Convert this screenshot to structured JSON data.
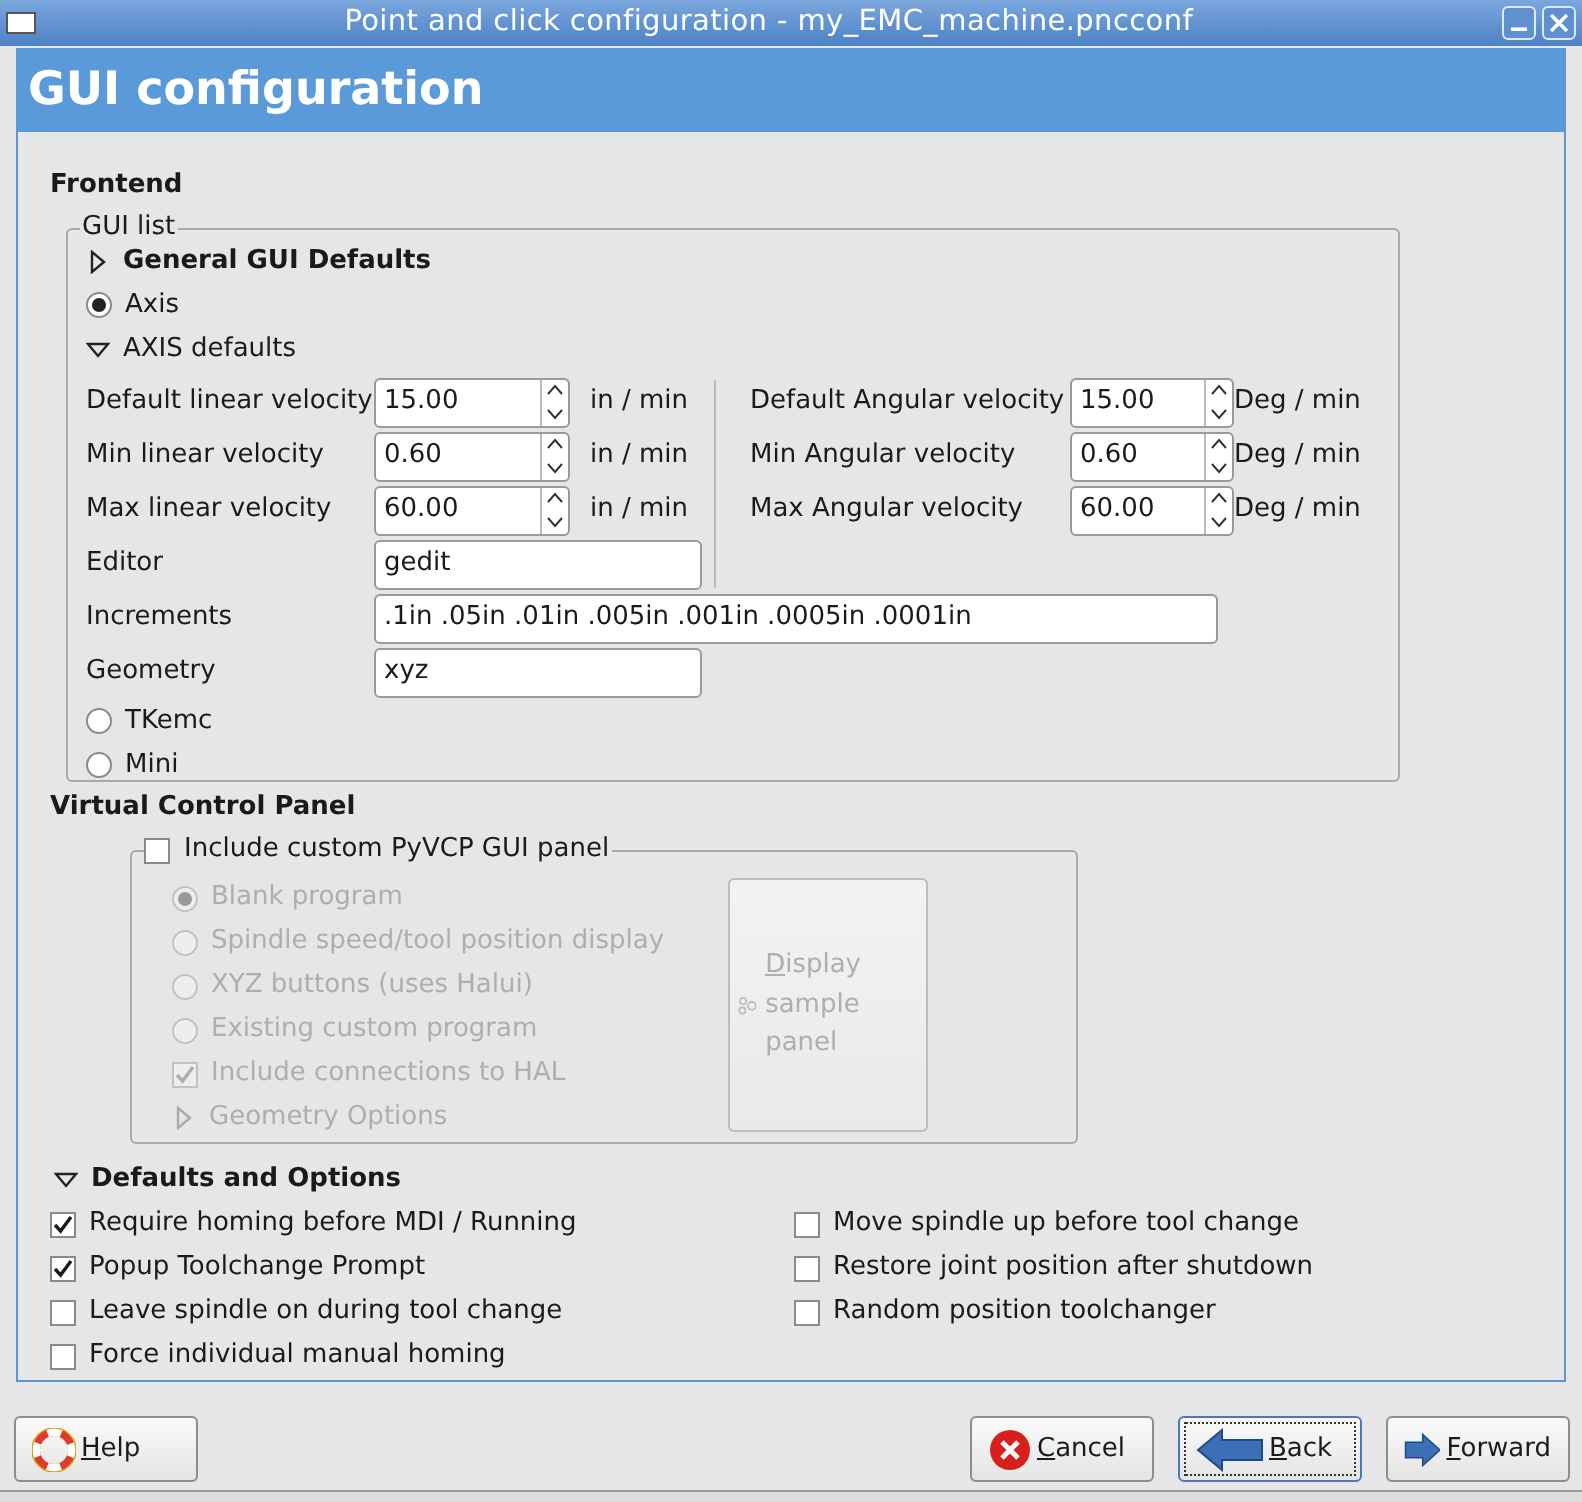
{
  "window": {
    "title": "Point and click configuration - my_EMC_machine.pncconf"
  },
  "header": {
    "title": "GUI configuration"
  },
  "frontend": {
    "title": "Frontend",
    "gui_list": {
      "legend": "GUI list",
      "general_defaults": {
        "label": "General GUI Defaults",
        "expanded": false
      },
      "frontends": [
        {
          "label": "Axis",
          "selected": true
        },
        {
          "label": "TKemc",
          "selected": false
        },
        {
          "label": "Mini",
          "selected": false
        }
      ],
      "axis_defaults": {
        "label": "AXIS defaults",
        "expanded": true,
        "linear_fields": [
          {
            "label": "Default linear velocity",
            "value": "15.00",
            "unit": "in / min"
          },
          {
            "label": "Min linear velocity",
            "value": "0.60",
            "unit": "in / min"
          },
          {
            "label": "Max linear velocity",
            "value": "60.00",
            "unit": "in / min"
          }
        ],
        "angular_fields": [
          {
            "label": "Default Angular velocity",
            "value": "15.00",
            "unit": "Deg / min"
          },
          {
            "label": "Min Angular velocity",
            "value": "0.60",
            "unit": "Deg / min"
          },
          {
            "label": "Max Angular velocity",
            "value": "60.00",
            "unit": "Deg / min"
          }
        ],
        "text_fields": [
          {
            "label": "Editor",
            "value": "gedit",
            "kind": "short"
          },
          {
            "label": "Increments",
            "value": ".1in .05in .01in .005in .001in .0005in .0001in",
            "kind": "long"
          },
          {
            "label": "Geometry",
            "value": "xyz",
            "kind": "short"
          }
        ]
      }
    }
  },
  "vcp": {
    "title": "Virtual Control Panel",
    "include": {
      "label": "Include custom PyVCP GUI panel",
      "checked": false
    },
    "disabled": true,
    "options": [
      {
        "label": "Blank program",
        "selected": true
      },
      {
        "label": "Spindle speed/tool position display",
        "selected": false
      },
      {
        "label": "XYZ buttons (uses Halui)",
        "selected": false
      },
      {
        "label": "Existing custom program",
        "selected": false
      }
    ],
    "hal": {
      "label": "Include connections to HAL",
      "checked": true
    },
    "geometry_options": {
      "label": "Geometry Options",
      "expanded": false
    },
    "display_button": {
      "label": "Display sample panel"
    }
  },
  "defaults": {
    "label": "Defaults and Options",
    "expanded": true,
    "left_options": [
      {
        "label": "Require homing before MDI / Running",
        "checked": true
      },
      {
        "label": "Popup Toolchange Prompt",
        "checked": true
      },
      {
        "label": "Leave spindle on during tool change",
        "checked": false
      },
      {
        "label": "Force individual manual homing",
        "checked": false
      }
    ],
    "right_options": [
      {
        "label": "Move spindle up before tool change",
        "checked": false
      },
      {
        "label": "Restore joint position after shutdown",
        "checked": false
      },
      {
        "label": "Random position toolchanger",
        "checked": false
      }
    ]
  },
  "buttons": [
    {
      "label": "Help",
      "kind": "help",
      "focused": false
    },
    {
      "label": "Cancel",
      "kind": "cancel",
      "focused": false
    },
    {
      "label": "Back",
      "kind": "back",
      "focused": true
    },
    {
      "label": "Forward",
      "kind": "forward",
      "focused": false
    }
  ]
}
